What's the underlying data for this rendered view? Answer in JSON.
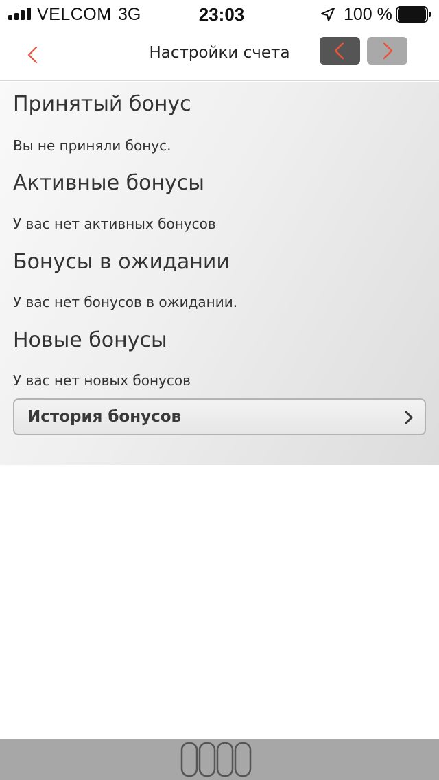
{
  "status_bar": {
    "carrier": "VELCOM",
    "network": "3G",
    "time": "23:03",
    "battery": "100 %",
    "icons": [
      "signal-icon",
      "location-icon",
      "battery-icon"
    ]
  },
  "nav": {
    "title": "Настройки счета",
    "back_icon": "chevron-left-icon",
    "prev_icon": "chevron-left-icon",
    "next_icon": "chevron-right-icon"
  },
  "sections": [
    {
      "heading": "Принятый бонус",
      "text": "Вы не приняли бонус."
    },
    {
      "heading": "Активные бонусы",
      "text": "У вас нет активных бонусов"
    },
    {
      "heading": "Бонусы в ожидании",
      "text": "У вас нет бонусов в ожидании."
    },
    {
      "heading": "Новые бонусы",
      "text": "У вас нет новых бонусов"
    }
  ],
  "history_button": {
    "label": "История бонусов",
    "icon": "chevron-right-icon"
  },
  "bottom_bar": {
    "icon": "tabs-icon"
  },
  "colors": {
    "accent": "#e8553a",
    "prev_button_bg": "#555555",
    "next_button_bg": "#a9a9a9",
    "panel_bg": "#eeeeee",
    "bottom_bar_bg": "#a7a7a7"
  }
}
